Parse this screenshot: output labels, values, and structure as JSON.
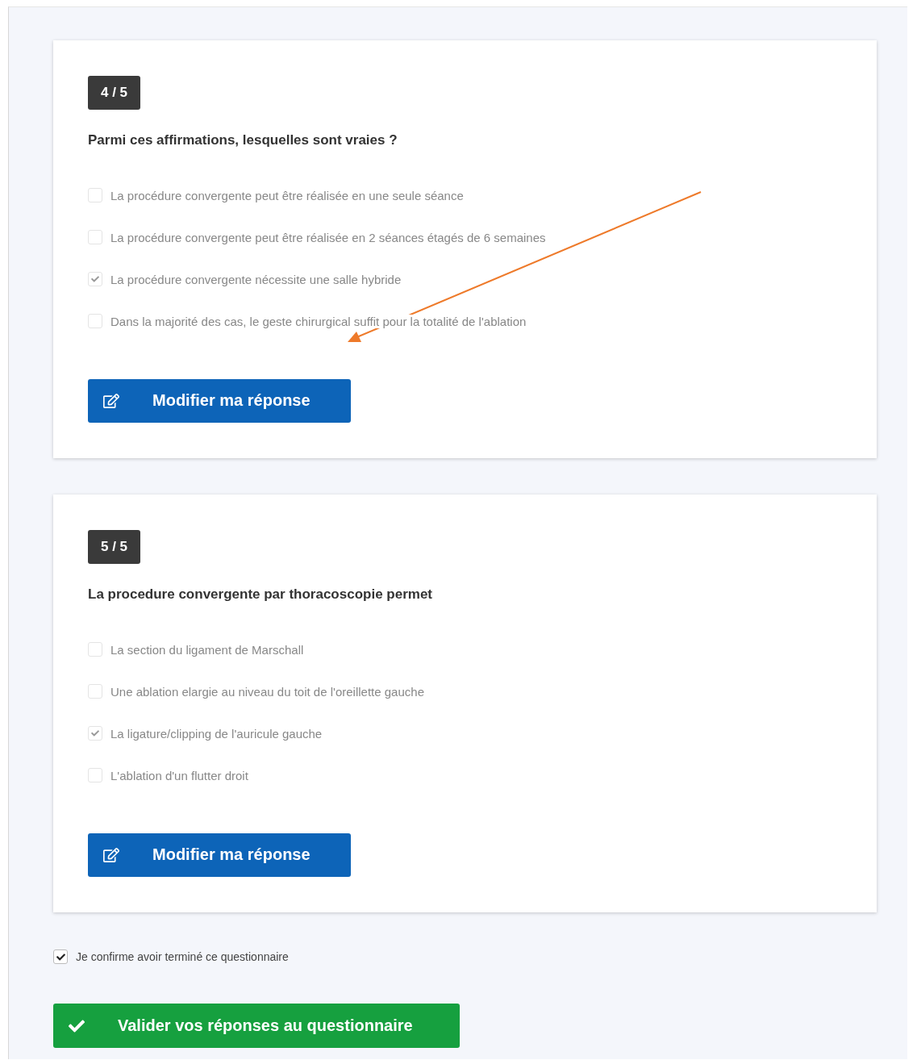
{
  "questions": [
    {
      "counter": "4 / 5",
      "title": "Parmi ces affirmations, lesquelles sont vraies ?",
      "options": [
        {
          "label": "La procédure convergente peut être réalisée en une seule séance",
          "checked": false
        },
        {
          "label": "La procédure convergente peut être réalisée en 2 séances étagés de 6 semaines",
          "checked": false
        },
        {
          "label": "La procédure convergente nécessite une salle hybride",
          "checked": true
        },
        {
          "label": "Dans la majorité des cas, le geste chirurgical suffit pour la totalité de l'ablation",
          "checked": false
        }
      ],
      "button": "Modifier ma réponse"
    },
    {
      "counter": "5 / 5",
      "title": "La procedure convergente par thoracoscopie permet",
      "options": [
        {
          "label": "La section du ligament de Marschall",
          "checked": false
        },
        {
          "label": "Une ablation elargie au niveau du toit de l'oreillette gauche",
          "checked": false
        },
        {
          "label": "La ligature/clipping de l'auricule gauche",
          "checked": true
        },
        {
          "label": "L'ablation d'un flutter droit",
          "checked": false
        }
      ],
      "button": "Modifier ma réponse"
    }
  ],
  "confirm": {
    "label": "Je confirme avoir terminé ce questionnaire",
    "checked": true
  },
  "submit": "Valider vos réponses au questionnaire"
}
